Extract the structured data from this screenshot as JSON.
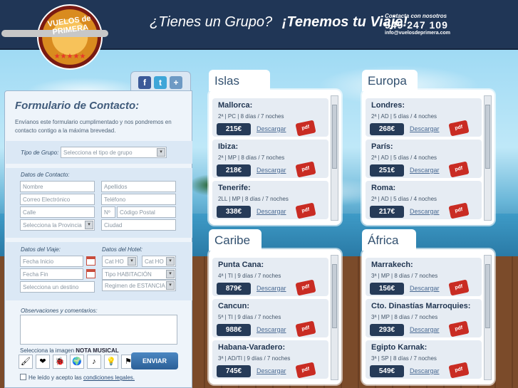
{
  "logo": {
    "text": "VUELOS de PRIMERA",
    "stars": "★★★★★"
  },
  "header": {
    "slogan_question": "¿Tienes un Grupo?",
    "slogan_answer": "¡Tenemos tu Viaje!",
    "contact_label": "Contacta con nosotros",
    "phone": "949 247 109",
    "email": "info@vuelosdeprimera.com"
  },
  "social": {
    "facebook": "f",
    "twitter": "t",
    "share": "+"
  },
  "form": {
    "title": "Formulario de Contacto:",
    "intro": "Envíanos este formulario cumplimentado y nos pondremos en contacto contigo a la máxima brevedad.",
    "tipo_grupo_label": "Tipo de Grupo:",
    "tipo_grupo_placeholder": "Selecciona el tipo de grupo",
    "datos_contacto_label": "Datos de Contacto:",
    "nombre": "Nombre",
    "apellidos": "Apellidos",
    "correo": "Correo Electrónico",
    "telefono": "Teléfono",
    "calle": "Calle",
    "numero": "Nº",
    "codigo_postal": "Código Postal",
    "provincia": "Selecciona la Provincia",
    "ciudad": "Ciudad",
    "datos_viaje_label": "Datos del Viaje:",
    "datos_hotel_label": "Datos del Hotel:",
    "fecha_inicio": "Fecha Inicio",
    "fecha_fin": "Fecha Fin",
    "destino": "Selecciona un destino",
    "cat_hotel_1": "Cat HO",
    "cat_hotel_2": "Cat HO",
    "tipo_habitacion": "Tipo HABITACIÓN",
    "regimen": "Regimen de ESTANCIA",
    "observaciones_label": "Observaciones y comentarios:",
    "nota_prefix": "Selecciona la imagen",
    "nota_name": "NOTA MUSICAL",
    "icons": [
      "🖌",
      "❤",
      "🐞",
      "🌍",
      "♪",
      "💡",
      "⚑"
    ],
    "enviar": "ENVIAR",
    "legal_prefix": "He leído y acepto las",
    "legal_link": "condiciones legales."
  },
  "download_label": "Descargar",
  "pdf_label": "pdf",
  "sections": [
    {
      "title": "Islas",
      "items": [
        {
          "name": "Mallorca:",
          "info": "2ª | PC | 8 días / 7 noches",
          "price": "215€"
        },
        {
          "name": "Ibiza:",
          "info": "2ª | MP | 8 días / 7 noches",
          "price": "218€"
        },
        {
          "name": "Tenerife:",
          "info": "2LL | MP | 8 días / 7 noches",
          "price": "338€"
        }
      ]
    },
    {
      "title": "Europa",
      "items": [
        {
          "name": "Londres:",
          "info": "2ª | AD | 5 días / 4 noches",
          "price": "268€"
        },
        {
          "name": "París:",
          "info": "2ª | AD | 5 días / 4 noches",
          "price": "251€"
        },
        {
          "name": "Roma:",
          "info": "2ª | AD | 5 días / 4 noches",
          "price": "217€"
        }
      ]
    },
    {
      "title": "Caribe",
      "items": [
        {
          "name": "Punta Cana:",
          "info": "4ª | TI | 9 días / 7 noches",
          "price": "879€"
        },
        {
          "name": "Cancun:",
          "info": "5ª | TI | 9 días / 7 noches",
          "price": "988€"
        },
        {
          "name": "Habana-Varadero:",
          "info": "3ª | AD/TI | 9 días / 7 noches",
          "price": "745€"
        }
      ]
    },
    {
      "title": "África",
      "items": [
        {
          "name": "Marrakech:",
          "info": "3ª | MP | 8 días / 7 noches",
          "price": "156€"
        },
        {
          "name": "Cto. Dinastías Marroquies:",
          "info": "3ª | MP | 8 días / 7 noches",
          "price": "293€"
        },
        {
          "name": "Egipto Karnak:",
          "info": "3ª | SP | 8 días / 7 noches",
          "price": "549€"
        }
      ]
    }
  ]
}
